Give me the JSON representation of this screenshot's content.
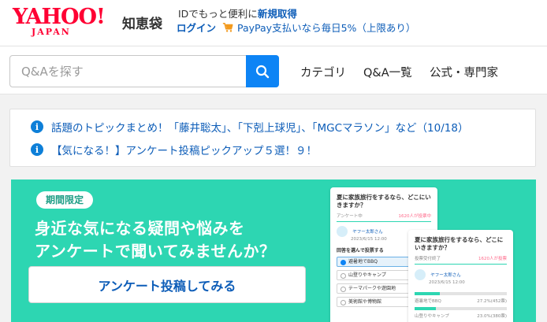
{
  "header": {
    "logo_main": "YAHOO!",
    "logo_sub": "JAPAN",
    "service_name": "知恵袋",
    "id_text": "IDでもっと便利に",
    "register_link": "新規取得",
    "login_link": "ログイン",
    "paypay_text": "PayPay支払いなら毎日5%（上限あり）",
    "brand_color": "#ff0033",
    "link_color": "#0d5db8"
  },
  "search": {
    "placeholder": "Q&Aを探す",
    "value": ""
  },
  "nav": {
    "items": [
      {
        "label": "カテゴリ"
      },
      {
        "label": "Q&A一覧"
      },
      {
        "label": "公式・専門家"
      }
    ]
  },
  "notices": [
    {
      "text": "話題のトピックまとめ！「藤井聡太」、「下剋上球児」、「MGCマラソン」など（10/18）"
    },
    {
      "text": "【気になる！】アンケート投稿ピックアップ５選！９！"
    }
  ],
  "banner": {
    "badge": "期間限定",
    "title_line1": "身近な気になる疑問や悩みを",
    "title_line2": "アンケートで聞いてみませんか？",
    "cta_label": "アンケート投稿してみる",
    "bg_color": "#2dd6b2",
    "card1": {
      "question": "夏に家族旅行をするなら、どこにいきますか？",
      "meta_left": "アンケート中",
      "meta_right": "1620人が投票中",
      "user": "ヤフー太郎さん",
      "date": "2023/6/15 12:00",
      "prompt": "回答を選んで投票する",
      "options": [
        {
          "label": "避暑地でBBQ",
          "selected": true
        },
        {
          "label": "山登りやキャンプ",
          "selected": false
        },
        {
          "label": "テーマパークや遊園地",
          "selected": false
        },
        {
          "label": "美術館や博物館",
          "selected": false
        }
      ]
    },
    "card2": {
      "question": "夏に家族旅行をするなら、どこにいきますか？",
      "meta_left": "投票受付終了",
      "meta_right": "1620人が投票",
      "user": "ヤフー太郎さん",
      "date": "2023/6/15 12:00",
      "results": [
        {
          "label": "避暑地でBBQ",
          "pct": 27.2,
          "text": "27.2%(452票)"
        },
        {
          "label": "山登りやキャンプ",
          "pct": 23.0,
          "text": "23.0%(380票)"
        }
      ]
    }
  }
}
